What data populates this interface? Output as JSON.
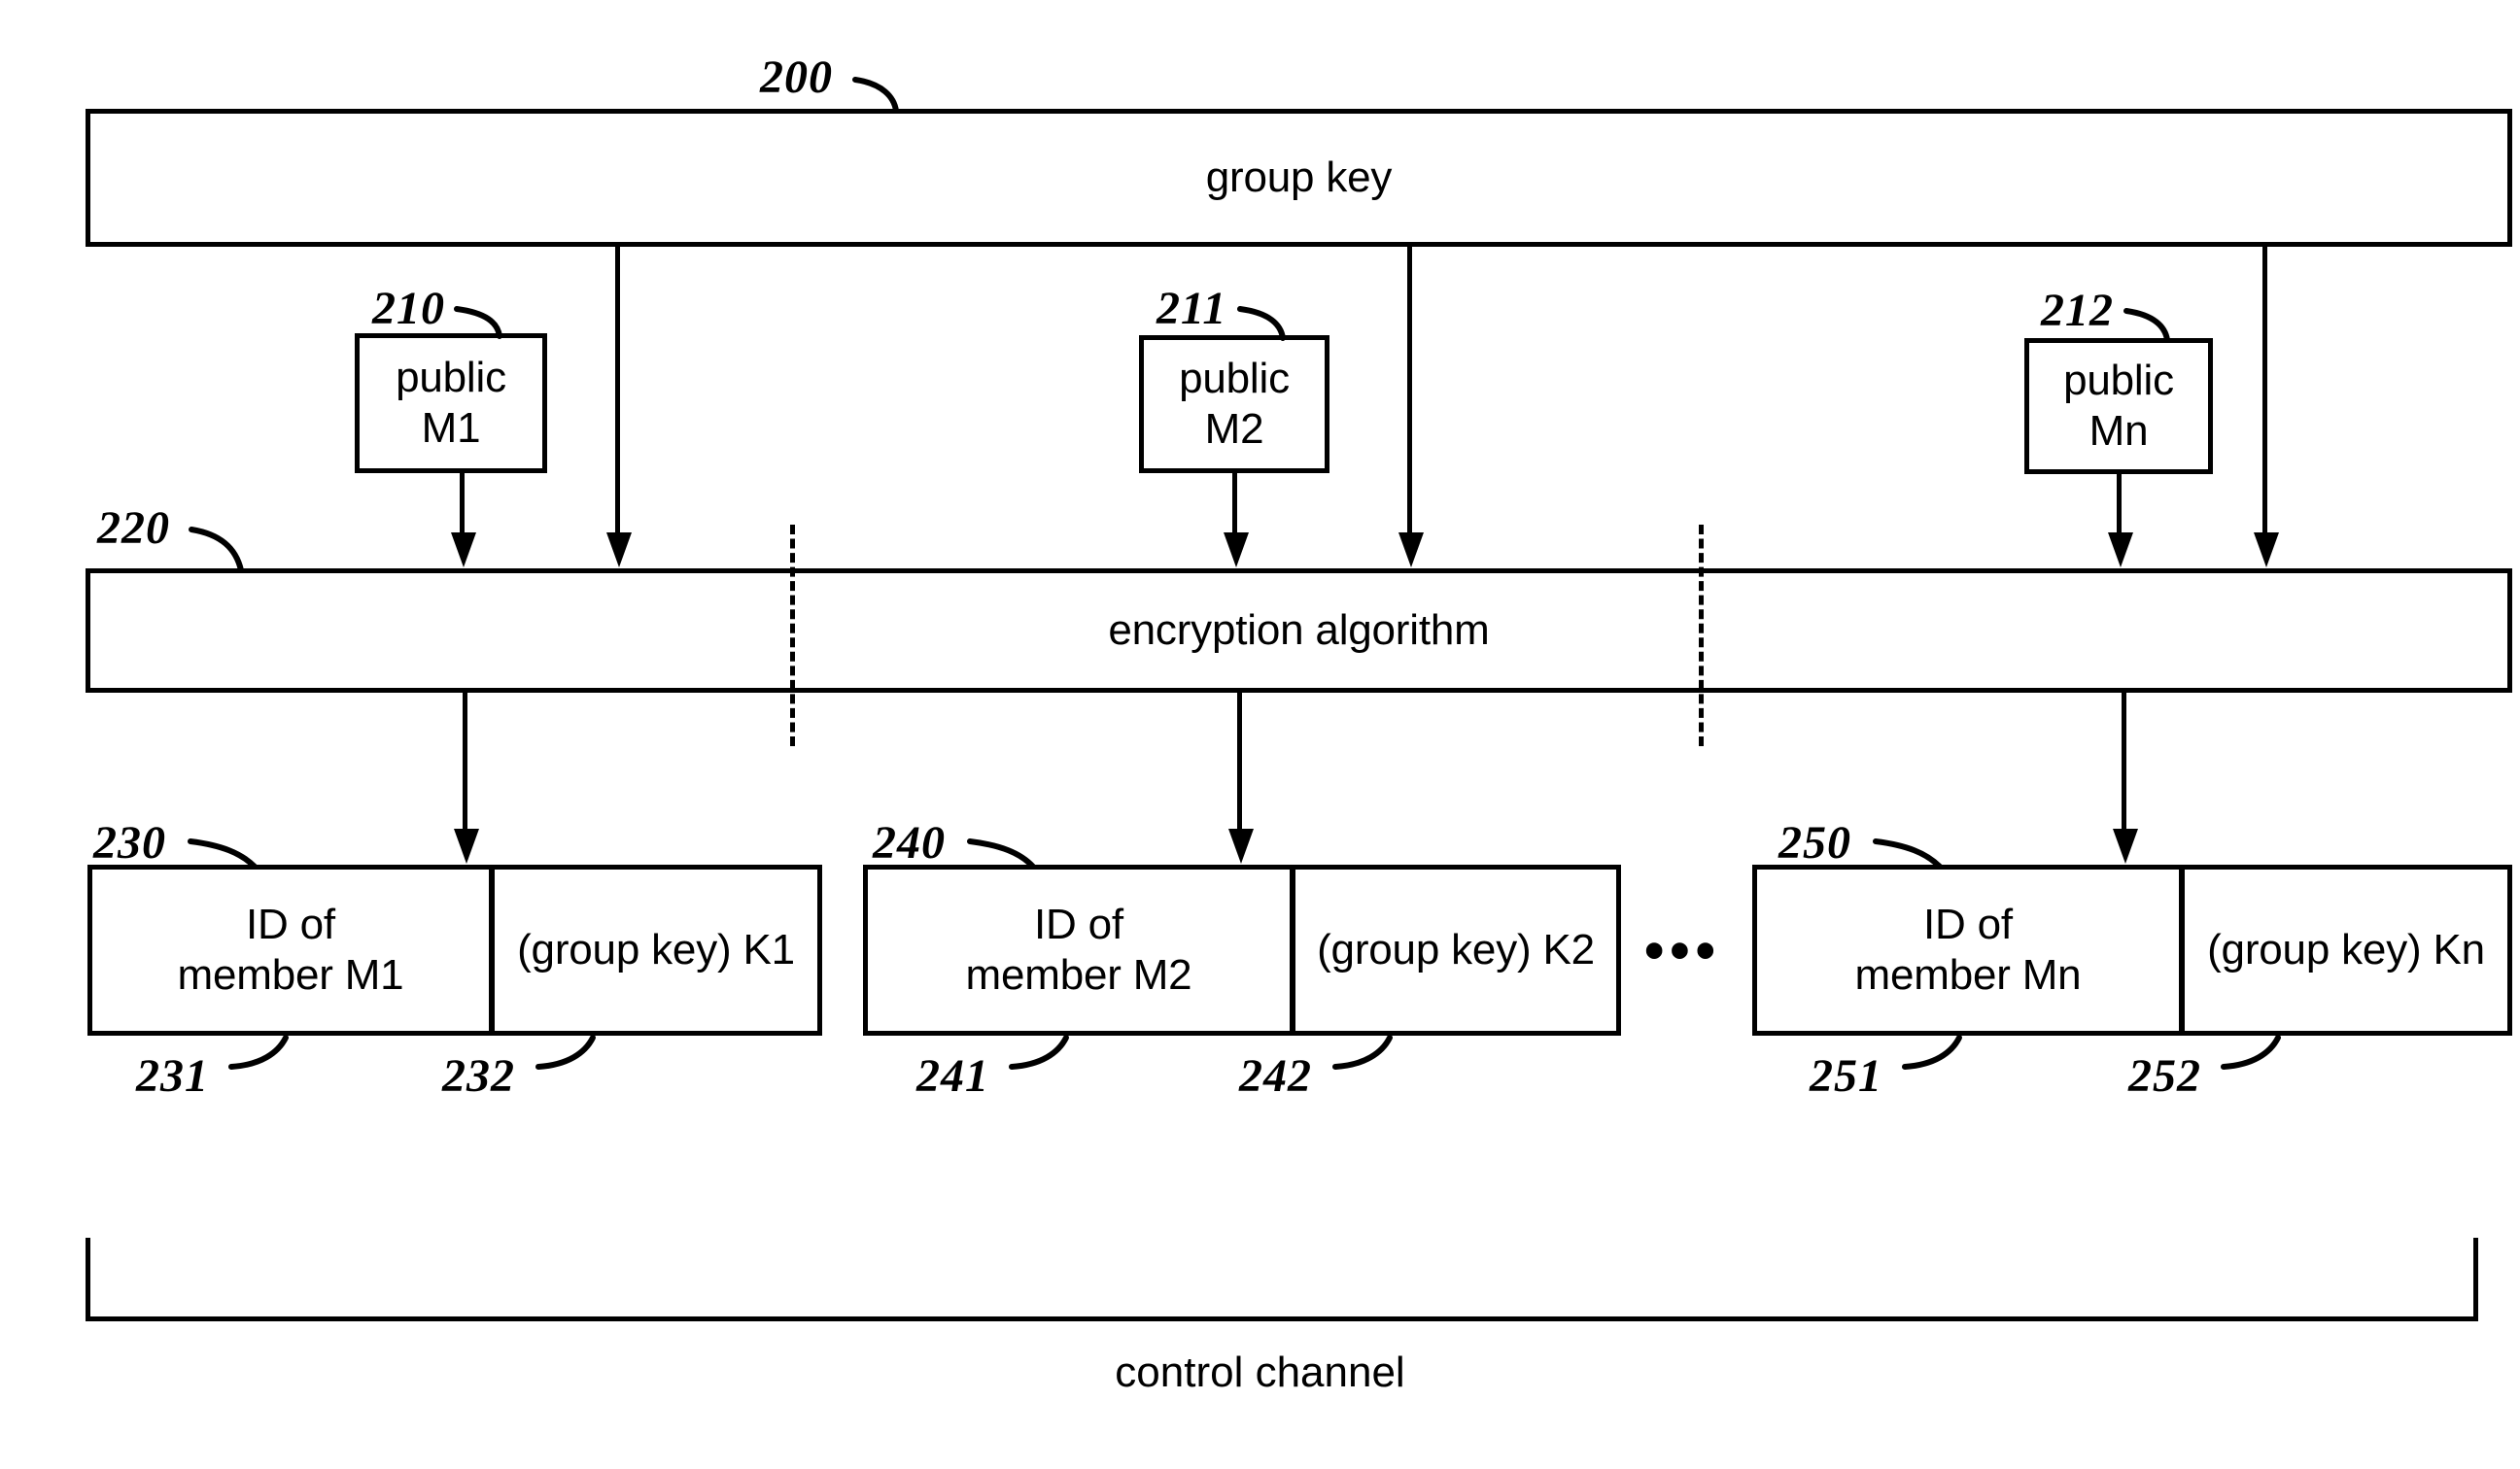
{
  "figure": {
    "top_block": {
      "ref": "200",
      "label": "group key"
    },
    "public_keys": [
      {
        "ref": "210",
        "label": "public\nM1"
      },
      {
        "ref": "211",
        "label": "public\nM2"
      },
      {
        "ref": "212",
        "label": "public\nMn"
      }
    ],
    "encryption": {
      "ref": "220",
      "label": "encryption algorithm"
    },
    "records": [
      {
        "ref": "230",
        "id_ref": "231",
        "key_ref": "232",
        "id_label": "ID of\nmember M1",
        "key_label": "(group key) K1"
      },
      {
        "ref": "240",
        "id_ref": "241",
        "key_ref": "242",
        "id_label": "ID of\nmember M2",
        "key_label": "(group key) K2"
      },
      {
        "ref": "250",
        "id_ref": "251",
        "key_ref": "252",
        "id_label": "ID of\nmember Mn",
        "key_label": "(group key) Kn"
      }
    ],
    "ellipsis": "•••",
    "channel": {
      "label": "control channel"
    }
  }
}
